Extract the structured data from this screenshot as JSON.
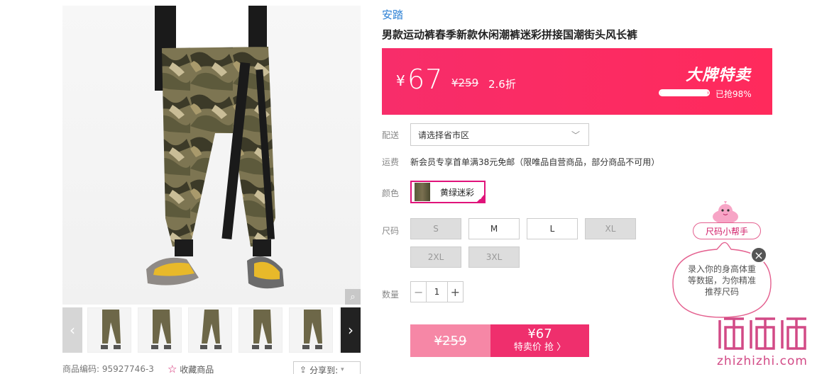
{
  "gallery": {
    "zoom_icon": "magnifier-icon",
    "prev_icon": "chevron-left-icon",
    "next_icon": "chevron-right-icon",
    "thumb_count": 6
  },
  "footer": {
    "sku_label": "商品编码:",
    "sku_value": "95927746-3",
    "favorite_label": "收藏商品",
    "share_label": "分享到:"
  },
  "product": {
    "brand": "安踏",
    "title": "男款运动裤春季新款休闲潮裤迷彩拼接国潮街头风长裤"
  },
  "price_banner": {
    "currency": "¥",
    "price": "67",
    "original_price": "¥259",
    "discount": "2.6折",
    "tag": "大牌特卖",
    "sold_fraction": 0.98,
    "sold_text": "已抢98%"
  },
  "delivery": {
    "label": "配送",
    "placeholder": "请选择省市区"
  },
  "freight": {
    "label": "运费",
    "text": "新会员专享首单满38元免邮（限唯品自营商品，部分商品不可用）"
  },
  "color": {
    "label": "颜色",
    "options": [
      {
        "name": "黄绿迷彩",
        "selected": true
      }
    ]
  },
  "size": {
    "label": "尺码",
    "options": [
      {
        "name": "S",
        "available": false
      },
      {
        "name": "M",
        "available": true
      },
      {
        "name": "L",
        "available": true
      },
      {
        "name": "XL",
        "available": false
      },
      {
        "name": "2XL",
        "available": false
      },
      {
        "name": "3XL",
        "available": false
      }
    ]
  },
  "quantity": {
    "label": "数量",
    "value": "1",
    "minus": "−",
    "plus": "+"
  },
  "buy": {
    "original_price": "¥259",
    "price": "¥67",
    "action": "特卖价 抢 〉"
  },
  "size_helper": {
    "title": "尺码小帮手",
    "text": "录入你的身高体重等数据，为你精准推荐尺码",
    "close": "×"
  },
  "watermark": {
    "logo": "值值值",
    "text": "zhizhizhi.com"
  },
  "colors": {
    "brand_blue": "#2a7fd4",
    "banner_pink": "#f72d6a",
    "accent_magenta": "#e0137a",
    "buy_left": "#f687a6",
    "buy_right": "#ef2f6d"
  }
}
